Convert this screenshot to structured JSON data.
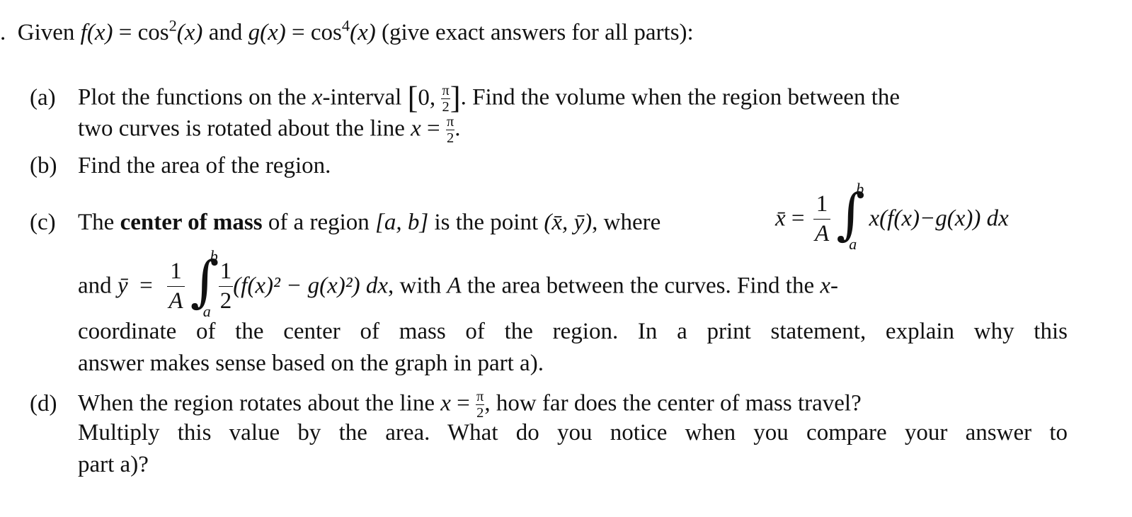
{
  "document": {
    "intro": {
      "number_marker": ".",
      "text_given": "Given",
      "f_def": "f(x)",
      "eq": "=",
      "f_rhs_base": "cos",
      "f_rhs_exp": "2",
      "f_rhs_arg": "(x)",
      "and": "and",
      "g_def": "g(x)",
      "g_rhs_base": "cos",
      "g_rhs_exp": "4",
      "g_rhs_arg": "(x)",
      "tail": "(give exact answers for all parts):"
    },
    "parts": [
      {
        "label": "(a)",
        "line1_pre": "Plot the functions on the ",
        "line1_var": "x",
        "line1_mid": "-interval ",
        "interval_open": "[",
        "interval_start": "0,",
        "pi": "π",
        "two": "2",
        "interval_close": "]",
        "line1_post": ". Find the volume when the region between the",
        "line2_pre": "two curves is rotated about the line ",
        "line2_var": "x",
        "line2_eq": "=",
        "line2_post": "."
      },
      {
        "label": "(b)",
        "text": "Find the area of the region."
      },
      {
        "label": "(c)",
        "line1_pre": "The ",
        "line1_bold": "center of mass",
        "line1_mid": " of a region ",
        "region": "[a, b]",
        "line1_mid2": " is the point ",
        "point": "(x̄, ȳ)",
        "line1_where": ", where ",
        "xbar": "x̄",
        "eq": "=",
        "one": "1",
        "A": "A",
        "upper": "b",
        "lower": "a",
        "xbar_integrand": "x(f(x)−g(x)) dx",
        "line2_and": "and ",
        "ybar": "ȳ",
        "half_num": "1",
        "half_den": "2",
        "ybar_integrand": "(f(x)² − g(x)²) dx",
        "line2_post_pre": ", with ",
        "line2_A": "A",
        "line2_post": " the area between the curves.  Find the ",
        "line2_var": "x",
        "line2_dash": "-",
        "line3": "coordinate of the center of mass of the region.  In a print statement, explain why this",
        "line4": "answer makes sense based on the graph in part a)."
      },
      {
        "label": "(d)",
        "line1_pre": "When the region rotates about the line ",
        "line1_var": "x",
        "line1_eq": "=",
        "pi": "π",
        "two": "2",
        "line1_post": ", how far does the center of mass travel?",
        "line2": "Multiply this value by the area.  What do you notice when you compare your answer to",
        "line3": "part a)?"
      }
    ]
  }
}
